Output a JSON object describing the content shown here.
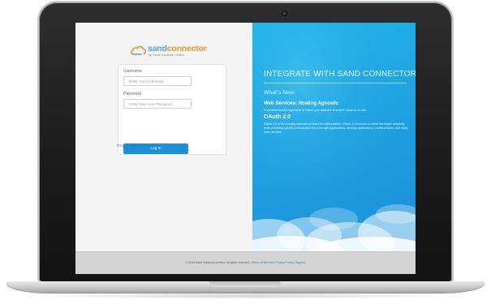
{
  "brand": {
    "word_sand": "sand",
    "word_connector": "connector",
    "tagline": "by Sand Solutions Limited",
    "colors": {
      "sand": "#4fa8dc",
      "connector": "#f3922d",
      "accent": "#1b8fdc"
    }
  },
  "login": {
    "username_label": "Username",
    "username_placeholder": "Enter Your Username",
    "password_label": "Password",
    "password_placeholder": "Enter Your User Password",
    "submit_label": "Log In",
    "forgot_link": "Forgot Your Password?"
  },
  "promo": {
    "title": "INTEGRATE WITH SAND CONNECTOR",
    "whats_new": "What`s New:",
    "item1_title": "Web Services: Hosting Agnostic",
    "item1_body": "Consistent results regardless of where your software is hosted: cloud or on-site.",
    "item2_title": "OAuth 2.0",
    "item2_body": "OAuth 2.0 is the industry-standard protocol for authorization. OAuth 2.0 focuses on client developer simplicity while providing specific authorization flows for web applications, desktop applications, mobile phones, and living room devices."
  },
  "footer": {
    "copyright": "© 2019 Sand Solutions Limited. All rights reserved. | ",
    "terms": "Terms of Service",
    "sep1": " | ",
    "privacy": "Privacy Policy",
    "sep2": " | ",
    "support": "Support"
  }
}
